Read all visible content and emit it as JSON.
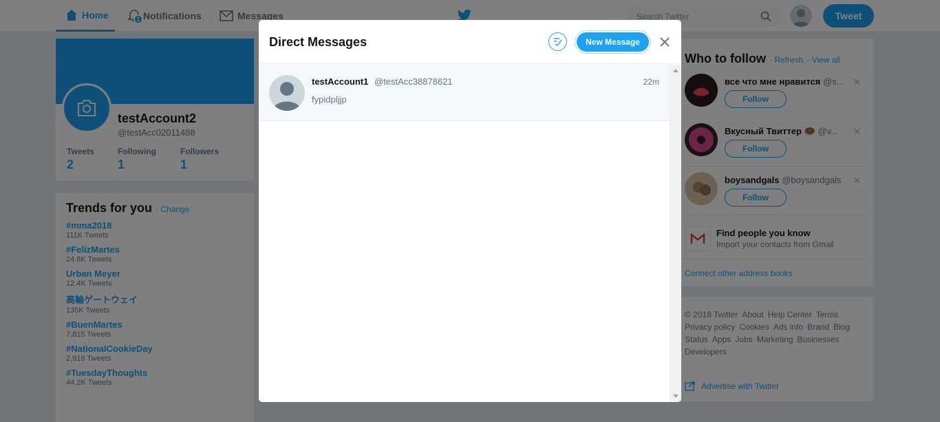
{
  "nav": {
    "home": "Home",
    "notifications": "Notifications",
    "notifications_badge": "1",
    "messages": "Messages",
    "search_placeholder": "Search Twitter",
    "tweet_button": "Tweet"
  },
  "profile": {
    "name": "testAccount2",
    "handle": "@testAcc02011488",
    "stats": [
      {
        "label": "Tweets",
        "value": "2"
      },
      {
        "label": "Following",
        "value": "1"
      },
      {
        "label": "Followers",
        "value": "1"
      }
    ]
  },
  "trends": {
    "title": "Trends for you",
    "change": "· Change",
    "items": [
      {
        "name": "#mma2018",
        "count": "111K Tweets"
      },
      {
        "name": "#FelizMartes",
        "count": "24.8K Tweets"
      },
      {
        "name": "Urban Meyer",
        "count": "12.4K Tweets"
      },
      {
        "name": "高輪ゲートウェイ",
        "count": "135K Tweets"
      },
      {
        "name": "#BuenMartes",
        "count": "7,815 Tweets"
      },
      {
        "name": "#NationalCookieDay",
        "count": "2,918 Tweets"
      },
      {
        "name": "#TuesdayThoughts",
        "count": "44.2K Tweets"
      }
    ]
  },
  "who_to_follow": {
    "title": "Who to follow",
    "refresh": "· Refresh",
    "view_all": "· View all",
    "users": [
      {
        "name": "все что мне нравится",
        "handle": "@s...",
        "follow": "Follow"
      },
      {
        "name": "Вкусный Твиттер 🍩",
        "handle": "@v...",
        "follow": "Follow"
      },
      {
        "name": "boysandgals",
        "handle": "@boysandgals",
        "follow": "Follow"
      }
    ],
    "find_title": "Find people you know",
    "find_sub": "Import your contacts from Gmail",
    "connect": "Connect other address books"
  },
  "footer": {
    "links": [
      "© 2018 Twitter",
      "About",
      "Help Center",
      "Terms",
      "Privacy policy",
      "Cookies",
      "Ads info",
      "Brand",
      "Blog",
      "Status",
      "Apps",
      "Jobs",
      "Marketing",
      "Businesses",
      "Developers"
    ],
    "advertise": "Advertise with Twitter"
  },
  "modal": {
    "title": "Direct Messages",
    "new_message": "New Message",
    "conversation": {
      "name": "testAccount1",
      "handle": "@testAcc38878621",
      "time": "22m",
      "preview": "fypidpljjp"
    }
  },
  "colors": {
    "accent": "#1da1f2",
    "background": "#e6ecf0"
  }
}
